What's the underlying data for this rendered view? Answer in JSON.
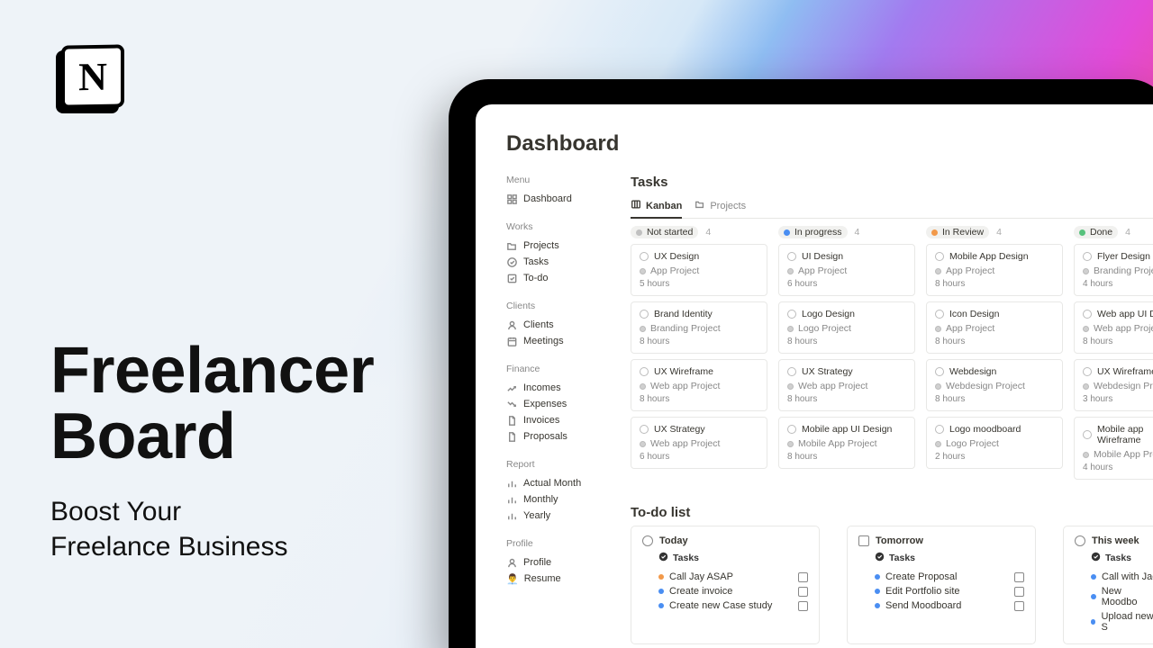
{
  "hero": {
    "title_line1": "Freelancer",
    "title_line2": "Board",
    "subtitle_line1": "Boost Your",
    "subtitle_line2": "Freelance Business"
  },
  "logo_letter": "N",
  "dashboard": {
    "title": "Dashboard",
    "sidebar": [
      {
        "header": "Menu",
        "items": [
          {
            "icon": "dashboard-icon",
            "label": "Dashboard"
          }
        ]
      },
      {
        "header": "Works",
        "items": [
          {
            "icon": "folder-icon",
            "label": "Projects"
          },
          {
            "icon": "check-circle-icon",
            "label": "Tasks"
          },
          {
            "icon": "checkbox-icon",
            "label": "To-do"
          }
        ]
      },
      {
        "header": "Clients",
        "items": [
          {
            "icon": "user-icon",
            "label": "Clients"
          },
          {
            "icon": "calendar-icon",
            "label": "Meetings"
          }
        ]
      },
      {
        "header": "Finance",
        "items": [
          {
            "icon": "trend-up-icon",
            "label": "Incomes"
          },
          {
            "icon": "trend-down-icon",
            "label": "Expenses"
          },
          {
            "icon": "document-icon",
            "label": "Invoices"
          },
          {
            "icon": "document-icon",
            "label": "Proposals"
          }
        ]
      },
      {
        "header": "Report",
        "items": [
          {
            "icon": "bar-chart-icon",
            "label": "Actual Month"
          },
          {
            "icon": "bar-chart-icon",
            "label": "Monthly"
          },
          {
            "icon": "bar-chart-icon",
            "label": "Yearly"
          }
        ]
      },
      {
        "header": "Profile",
        "items": [
          {
            "icon": "user-icon",
            "label": "Profile"
          },
          {
            "icon": "emoji",
            "emoji": "👨‍💼",
            "label": "Resume"
          }
        ]
      }
    ],
    "tasks": {
      "heading": "Tasks",
      "tabs": [
        {
          "icon": "board-icon",
          "label": "Kanban",
          "active": true
        },
        {
          "icon": "folder-icon",
          "label": "Projects",
          "active": false
        }
      ],
      "columns": [
        {
          "label": "Not started",
          "count": 4,
          "dot": "#c0c0c0",
          "cards": [
            {
              "title": "UX Design",
              "project": "App Project",
              "hours": "5 hours"
            },
            {
              "title": "Brand Identity",
              "project": "Branding Project",
              "hours": "8 hours"
            },
            {
              "title": "UX Wireframe",
              "project": "Web app Project",
              "hours": "8 hours"
            },
            {
              "title": "UX Strategy",
              "project": "Web app Project",
              "hours": "6 hours"
            }
          ]
        },
        {
          "label": "In progress",
          "count": 4,
          "dot": "#4a8ef2",
          "cards": [
            {
              "title": "UI Design",
              "project": "App Project",
              "hours": "6 hours"
            },
            {
              "title": "Logo Design",
              "project": "Logo Project",
              "hours": "8 hours"
            },
            {
              "title": "UX Strategy",
              "project": "Web app Project",
              "hours": "8 hours"
            },
            {
              "title": "Mobile app UI Design",
              "project": "Mobile App Project",
              "hours": "8 hours"
            }
          ]
        },
        {
          "label": "In Review",
          "count": 4,
          "dot": "#f2994a",
          "cards": [
            {
              "title": "Mobile App Design",
              "project": "App Project",
              "hours": "8 hours"
            },
            {
              "title": "Icon Design",
              "project": "App Project",
              "hours": "8 hours"
            },
            {
              "title": "Webdesign",
              "project": "Webdesign Project",
              "hours": "8 hours"
            },
            {
              "title": "Logo moodboard",
              "project": "Logo Project",
              "hours": "2 hours"
            }
          ]
        },
        {
          "label": "Done",
          "count": 4,
          "dot": "#57c27d",
          "cards": [
            {
              "title": "Flyer Design",
              "project": "Branding Project",
              "hours": "4 hours"
            },
            {
              "title": "Web app UI Design",
              "project": "Web app Project",
              "hours": "8 hours"
            },
            {
              "title": "UX Wireframe",
              "project": "Webdesign Project",
              "hours": "3 hours"
            },
            {
              "title": "Mobile app Wireframe",
              "project": "Mobile App Project",
              "hours": "4 hours"
            }
          ]
        }
      ]
    },
    "todo": {
      "heading": "To-do list",
      "groups": [
        {
          "title": "Today",
          "icon": "circle",
          "sub": "Tasks",
          "tasks": [
            {
              "bullet": "#f2994a",
              "label": "Call Jay ASAP"
            },
            {
              "bullet": "#4a8ef2",
              "label": "Create invoice"
            },
            {
              "bullet": "#4a8ef2",
              "label": "Create new Case study"
            }
          ]
        },
        {
          "title": "Tomorrow",
          "icon": "square",
          "sub": "Tasks",
          "tasks": [
            {
              "bullet": "#4a8ef2",
              "label": "Create Proposal"
            },
            {
              "bullet": "#4a8ef2",
              "label": "Edit Portfolio site"
            },
            {
              "bullet": "#4a8ef2",
              "label": "Send Moodboard"
            }
          ]
        },
        {
          "title": "This week",
          "icon": "circle",
          "sub": "Tasks",
          "tasks": [
            {
              "bullet": "#4a8ef2",
              "label": "Call with Jac"
            },
            {
              "bullet": "#4a8ef2",
              "label": "New Moodbo"
            },
            {
              "bullet": "#4a8ef2",
              "label": "Upload new S"
            }
          ]
        }
      ]
    }
  }
}
